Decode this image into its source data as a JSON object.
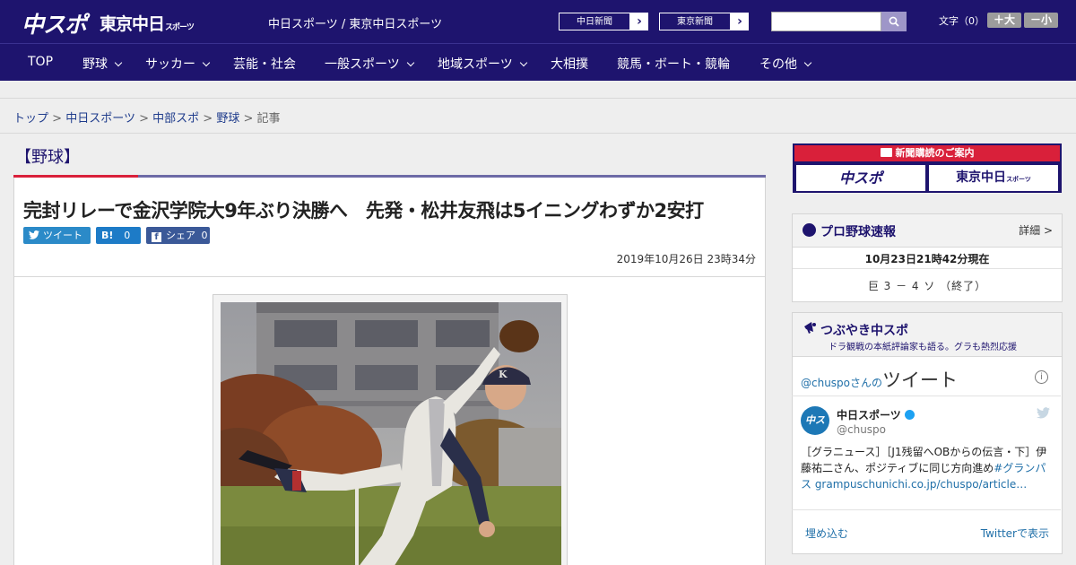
{
  "header": {
    "logo_chuspo": "中スポ",
    "logo_tokyo": "東京中日",
    "logo_tokyo_sub": "スポーツ",
    "site_name": "中日スポーツ / 東京中日スポーツ",
    "paper_links": [
      "中日新聞",
      "東京新聞"
    ],
    "font_size_label": "文字（0）",
    "font_plus": "＋大",
    "font_minus": "－小",
    "colors": {
      "brand": "#1e146e",
      "accent": "#d9203a"
    }
  },
  "nav": {
    "items": [
      {
        "label": "TOP",
        "has_menu": false
      },
      {
        "label": "野球",
        "has_menu": true
      },
      {
        "label": "サッカー",
        "has_menu": true
      },
      {
        "label": "芸能・社会",
        "has_menu": false
      },
      {
        "label": "一般スポーツ",
        "has_menu": true
      },
      {
        "label": "地域スポーツ",
        "has_menu": true
      },
      {
        "label": "大相撲",
        "has_menu": false
      },
      {
        "label": "競馬・ボート・競輪",
        "has_menu": false
      },
      {
        "label": "その他",
        "has_menu": true
      }
    ]
  },
  "breadcrumb": {
    "items": [
      "トップ",
      "中日スポーツ",
      "中部スポ",
      "野球"
    ],
    "current": "記事",
    "separator": ">"
  },
  "article": {
    "category": "【野球】",
    "headline": "完封リレーで金沢学院大9年ぶり決勝へ　先発・松井友飛は5イニングわずか2安打",
    "share": {
      "tweet_label": "ツイート",
      "hatena_label": "B!",
      "hatena_count": "0",
      "facebook_label": "シェア",
      "facebook_count": "0"
    },
    "date": "2019年10月26日 23時34分"
  },
  "sidebar": {
    "subscribe": {
      "header": "新聞購読のご案内",
      "paper1": "中スポ",
      "paper2": "東京中日",
      "paper2_sub": "スポーツ"
    },
    "baseball": {
      "title": "プロ野球速報",
      "more": "詳細 >",
      "time": "10月23日21時42分現在",
      "score": "巨 3 － 4 ソ （終了）"
    },
    "tweets": {
      "title": "つぶやき中スポ",
      "subtitle": "ドラ観戦の本紙評論家も語る。グラも熱烈応援",
      "handle": "@chuspo",
      "handle_suffix": "さんの",
      "tweets_word": "ツイート",
      "avatar_text": "中スポ",
      "user_name": "中日スポーツ",
      "user_handle": "@chuspo",
      "text_plain": "［グラニュース］［J1残留へOBからの伝言・下］伊藤祐二さん、ポジティブに同じ方向進め",
      "text_link": "#グランパス grampuschunichi.co.jp/chuspo/article…",
      "embed_label": "埋め込む",
      "view_label": "Twitterで表示"
    }
  }
}
